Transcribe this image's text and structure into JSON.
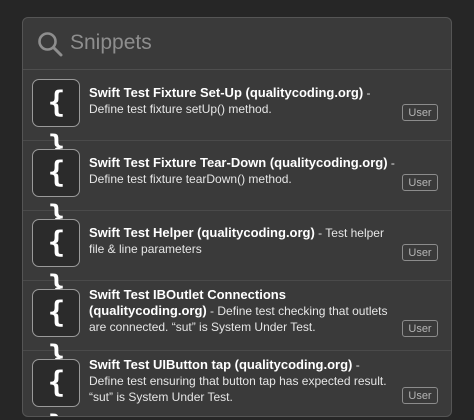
{
  "search": {
    "placeholder": "Snippets"
  },
  "icons": {
    "search": "search-icon",
    "snippet": "curly-braces-icon"
  },
  "snippet_glyph": "{ }",
  "items": [
    {
      "title": "Swift Test Fixture Set-Up (qualitycoding.org)",
      "separator": " - ",
      "description": "Define test fixture setUp() method.",
      "badge": "User"
    },
    {
      "title": "Swift Test Fixture Tear-Down (qualitycoding.org)",
      "separator": " - ",
      "description": "Define test fixture tearDown() method.",
      "badge": "User"
    },
    {
      "title": "Swift Test Helper (qualitycoding.org)",
      "separator": " - ",
      "description": "Test helper file & line parameters",
      "badge": "User"
    },
    {
      "title": "Swift Test IBOutlet Connections (qualitycoding.org)",
      "separator": " - ",
      "description": "Define test checking that outlets are connected. “sut” is System Under Test.",
      "badge": "User"
    },
    {
      "title": "Swift Test UIButton tap (qualitycoding.org)",
      "separator": " - ",
      "description": "Define test ensuring that button tap has expected result. “sut” is System Under Test.",
      "badge": "User"
    }
  ]
}
